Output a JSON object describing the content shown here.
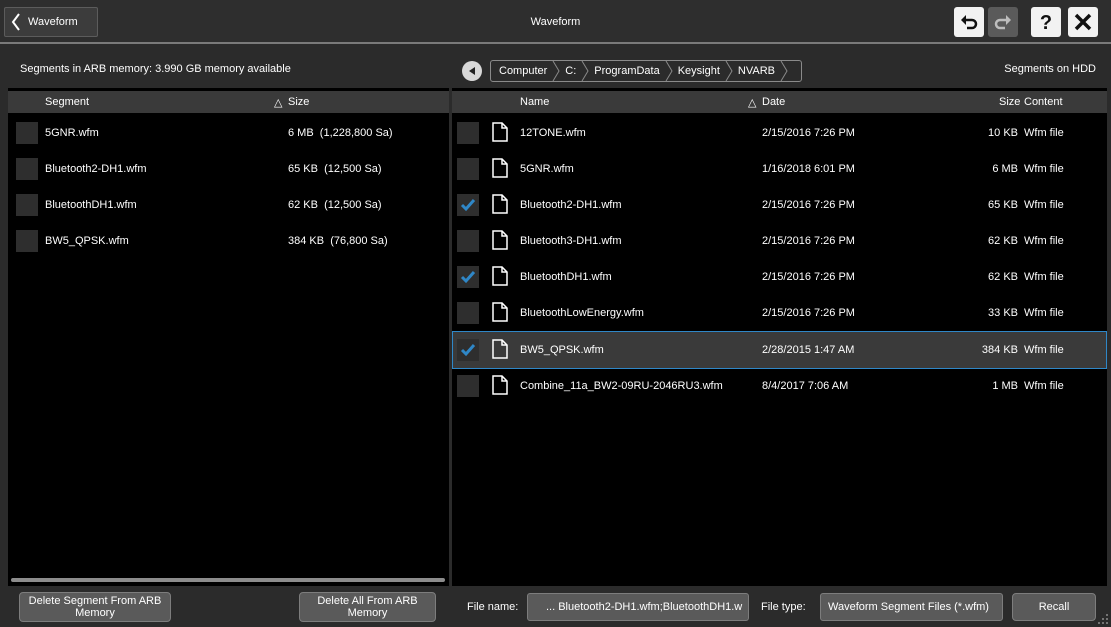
{
  "header": {
    "back_label": "Waveform",
    "title": "Waveform",
    "icons": [
      "undo-icon",
      "redo-icon",
      "help-icon",
      "close-icon"
    ]
  },
  "left": {
    "info": "Segments in ARB memory: 3.990 GB memory available",
    "columns": {
      "segment": "Segment",
      "sort_glyph": "△",
      "size": "Size"
    },
    "rows": [
      {
        "name": "5GNR.wfm",
        "size": "6 MB  (1,228,800 Sa)"
      },
      {
        "name": "Bluetooth2-DH1.wfm",
        "size": "65 KB  (12,500 Sa)"
      },
      {
        "name": "BluetoothDH1.wfm",
        "size": "62 KB  (12,500 Sa)"
      },
      {
        "name": "BW5_QPSK.wfm",
        "size": "384 KB  (76,800 Sa)"
      }
    ]
  },
  "right": {
    "title": "Segments on HDD",
    "breadcrumb": [
      "Computer",
      "C:",
      "ProgramData",
      "Keysight",
      "NVARB"
    ],
    "columns": {
      "name": "Name",
      "sort_glyph": "△",
      "date": "Date",
      "size": "Size",
      "content": "Content"
    },
    "rows": [
      {
        "name": "12TONE.wfm",
        "date": "2/15/2016 7:26 PM",
        "size": "10 KB",
        "content": "Wfm file",
        "checked": false
      },
      {
        "name": "5GNR.wfm",
        "date": "1/16/2018 6:01 PM",
        "size": "6 MB",
        "content": "Wfm file",
        "checked": false
      },
      {
        "name": "Bluetooth2-DH1.wfm",
        "date": "2/15/2016 7:26 PM",
        "size": "65 KB",
        "content": "Wfm file",
        "checked": true
      },
      {
        "name": "Bluetooth3-DH1.wfm",
        "date": "2/15/2016 7:26 PM",
        "size": "62 KB",
        "content": "Wfm file",
        "checked": false
      },
      {
        "name": "BluetoothDH1.wfm",
        "date": "2/15/2016 7:26 PM",
        "size": "62 KB",
        "content": "Wfm file",
        "checked": true
      },
      {
        "name": "BluetoothLowEnergy.wfm",
        "date": "2/15/2016 7:26 PM",
        "size": "33 KB",
        "content": "Wfm file",
        "checked": false
      },
      {
        "name": "BW5_QPSK.wfm",
        "date": "2/28/2015 1:47 AM",
        "size": "384 KB",
        "content": "Wfm file",
        "checked": true,
        "selected": true
      },
      {
        "name": "Combine_11a_BW2-09RU-2046RU3.wfm",
        "date": "8/4/2017 7:06 AM",
        "size": "1 MB",
        "content": "Wfm file",
        "checked": false
      }
    ]
  },
  "footer": {
    "delete_segment": "Delete Segment From ARB Memory",
    "delete_all": "Delete All From ARB Memory",
    "file_name_label": "File name:",
    "file_name_value": "... Bluetooth2-DH1.wfm;BluetoothDH1.w",
    "file_type_label": "File type:",
    "file_type_value": "Waveform Segment Files (*.wfm)",
    "recall": "Recall"
  },
  "colors": {
    "accent": "#2f87c7",
    "background": "#000000",
    "chrome": "#2b2b2b",
    "button": "#5a5a5a"
  }
}
